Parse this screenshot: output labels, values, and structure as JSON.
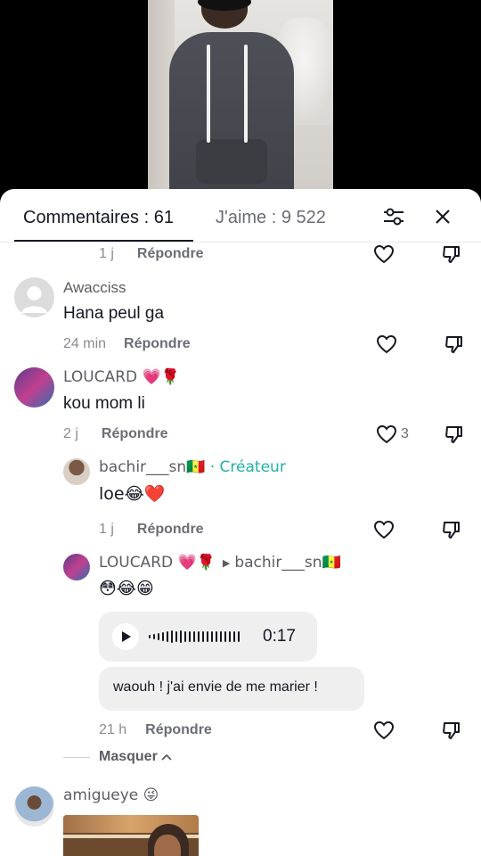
{
  "tabs": {
    "comments": "Commentaires : 61",
    "likes": "J'aime : 9 522"
  },
  "comments": [
    {
      "time": "1 j",
      "reply": "Répondre"
    },
    {
      "username": "Awacciss",
      "text": "Hana peul ga",
      "time": "24 min",
      "reply": "Répondre"
    },
    {
      "username": "LOUCARD 💗🌹",
      "text": "kou mom li",
      "time": "2 j",
      "reply": "Répondre",
      "likes": "3"
    }
  ],
  "replies": [
    {
      "username": "bachir___sn🇸🇳",
      "badge": "· Créateur",
      "text": "loe😂❤️",
      "time": "1 j",
      "reply": "Répondre"
    },
    {
      "username": "LOUCARD 💗🌹",
      "reply_to": "bachir___sn🇸🇳",
      "text": "😳😂😁",
      "audio_duration": "0:17",
      "bubble_text": "waouh ! j'ai envie de me marier !",
      "time": "21 h",
      "reply": "Répondre"
    }
  ],
  "hide_label": "Masquer",
  "last_comment": {
    "username": "amigueye 😜"
  },
  "icons": {
    "filter": "sliders-icon",
    "close": "close-icon",
    "like": "heart-outline-icon",
    "dislike": "thumbs-down-icon",
    "play": "play-icon"
  },
  "colors": {
    "creator": "#20b2a8",
    "text": "#161823",
    "muted": "#8a8b91"
  }
}
